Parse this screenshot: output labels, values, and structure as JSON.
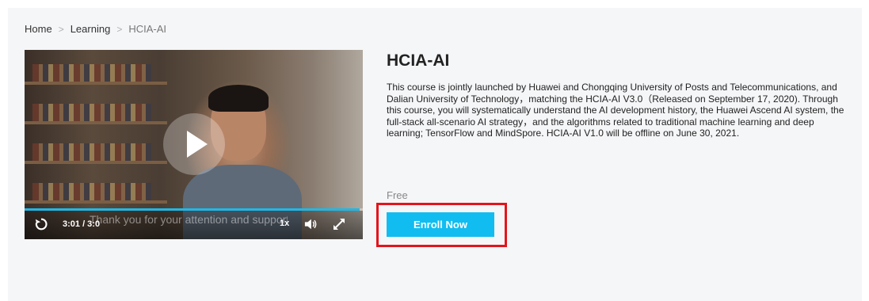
{
  "breadcrumb": {
    "items": [
      "Home",
      "Learning",
      "HCIA-AI"
    ],
    "separator": ">"
  },
  "video": {
    "time": "3:01 / 3:0",
    "subtitle": "Thank you for your attention and support",
    "speed": "1x",
    "progress": 0.99,
    "accent_color": "#1fb8e6",
    "icons": [
      "play-icon",
      "replay-icon",
      "volume-icon",
      "fullscreen-icon"
    ]
  },
  "course": {
    "title": "HCIA-AI",
    "description": "This course is jointly launched by Huawei and Chongqing University of Posts and Telecommunications, and Dalian University of Technology，matching the HCIA-AI V3.0（Released on September 17, 2020). Through this course, you will systematically understand the AI development history, the Huawei Ascend AI system, the full-stack all-scenario AI strategy，and the algorithms related to traditional machine learning and deep learning; TensorFlow and MindSpore. HCIA-AI V1.0 will be offline on June 30, 2021.",
    "price": "Free",
    "enroll_label": "Enroll Now",
    "enroll_color": "#11bdf0",
    "highlight_color": "#e3141c"
  }
}
